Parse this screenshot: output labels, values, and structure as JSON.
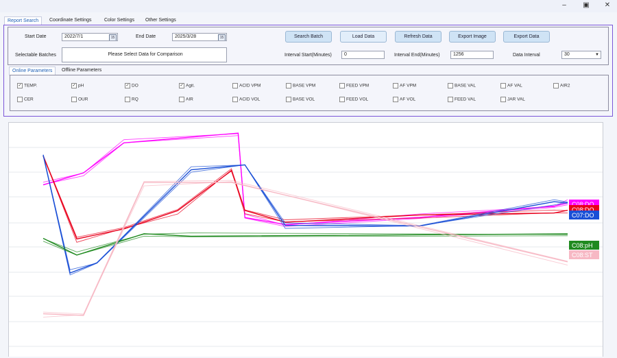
{
  "window": {
    "minimize_icon": "minimize-icon",
    "restore_icon": "restore-icon",
    "close_icon": "close-icon"
  },
  "top_tabs": [
    {
      "label": "Report Search",
      "active": true
    },
    {
      "label": "Coordinate Settings",
      "active": false
    },
    {
      "label": "Color Settings",
      "active": false
    },
    {
      "label": "Other Settings",
      "active": false
    }
  ],
  "search": {
    "start_date_label": "Start Date",
    "start_date_value": "2022/7/1",
    "end_date_label": "End Date",
    "end_date_value": "2025/3/28",
    "calendar_icon": "calendar-icon",
    "selectable_batches_label": "Selectable Batches",
    "selectable_batches_value": "Please Select Data for Comparison",
    "interval_start_label": "Interval Start(Minutes)",
    "interval_start_value": "0",
    "interval_end_label": "Interval End(Minutes)",
    "interval_end_value": "1256",
    "data_interval_label": "Data Interval",
    "data_interval_value": "30"
  },
  "buttons": {
    "search_batch": "Search Batch",
    "load_data": "Load Data",
    "refresh_data": "Refresh Data",
    "export_image": "Export Image",
    "export_data": "Export Data"
  },
  "param_tabs": [
    {
      "label": "Online Parameters",
      "active": true
    },
    {
      "label": "Offline Parameters",
      "active": false
    }
  ],
  "parameters": [
    {
      "label": "TEMP.",
      "checked": true
    },
    {
      "label": "pH",
      "checked": true
    },
    {
      "label": "DO",
      "checked": true
    },
    {
      "label": "Agit.",
      "checked": true
    },
    {
      "label": "ACID VPM",
      "checked": false
    },
    {
      "label": "BASE VPM",
      "checked": false
    },
    {
      "label": "FEED VPM",
      "checked": false
    },
    {
      "label": "AF VPM",
      "checked": false
    },
    {
      "label": "BASE VAL",
      "checked": false
    },
    {
      "label": "AF VAL",
      "checked": false
    },
    {
      "label": "AIR2",
      "checked": false
    },
    {
      "label": "CER",
      "checked": false
    },
    {
      "label": "OUR",
      "checked": false
    },
    {
      "label": "RQ",
      "checked": false
    },
    {
      "label": "AIR",
      "checked": false
    },
    {
      "label": "ACID VOL",
      "checked": false
    },
    {
      "label": "BASE VOL",
      "checked": false
    },
    {
      "label": "FEED VOL",
      "checked": false
    },
    {
      "label": "AF VOL",
      "checked": false
    },
    {
      "label": "FEED VAL",
      "checked": false
    },
    {
      "label": "JAR VAL",
      "checked": false
    }
  ],
  "chart_labels": [
    {
      "text": "C08:DO",
      "color": "#ff00ff",
      "text_color": "#ffffff"
    },
    {
      "text": "C08:DO",
      "color": "#e8001c",
      "text_color": "#ffffff"
    },
    {
      "text": "C07:DO",
      "color": "#1a4fd6",
      "text_color": "#ffffff"
    },
    {
      "text": "C08:pH",
      "color": "#1f8a1f",
      "text_color": "#ffffff"
    },
    {
      "text": "C08:ST",
      "color": "#f7b8c4",
      "text_color": "#ffffff"
    }
  ],
  "chart_data": {
    "type": "line",
    "grid": true,
    "series": [
      {
        "name": "C08:DO",
        "color": "#ff00ff",
        "points": [
          [
            0,
            0.74
          ],
          [
            60,
            0.78
          ],
          [
            120,
            0.92
          ],
          [
            290,
            0.95
          ],
          [
            300,
            0.6
          ],
          [
            360,
            0.56
          ],
          [
            560,
            0.6
          ],
          [
            760,
            0.64
          ],
          [
            780,
            0.66
          ]
        ]
      },
      {
        "name": "C08:DO",
        "color": "#e8001c",
        "points": [
          [
            0,
            0.86
          ],
          [
            50,
            0.5
          ],
          [
            120,
            0.55
          ],
          [
            200,
            0.62
          ],
          [
            280,
            0.8
          ],
          [
            300,
            0.62
          ],
          [
            360,
            0.58
          ],
          [
            560,
            0.6
          ],
          [
            760,
            0.62
          ],
          [
            780,
            0.62
          ]
        ]
      },
      {
        "name": "C07:DO",
        "color": "#1a4fd6",
        "points": [
          [
            0,
            0.86
          ],
          [
            40,
            0.36
          ],
          [
            80,
            0.4
          ],
          [
            220,
            0.8
          ],
          [
            300,
            0.82
          ],
          [
            360,
            0.56
          ],
          [
            560,
            0.56
          ],
          [
            760,
            0.66
          ],
          [
            780,
            0.66
          ]
        ]
      },
      {
        "name": "C08:pH",
        "color": "#1f8a1f",
        "points": [
          [
            0,
            0.5
          ],
          [
            50,
            0.44
          ],
          [
            150,
            0.52
          ],
          [
            220,
            0.52
          ],
          [
            780,
            0.52
          ]
        ]
      },
      {
        "name": "C08:ST",
        "color": "#f7b8c4",
        "points": [
          [
            0,
            0.18
          ],
          [
            60,
            0.18
          ],
          [
            150,
            0.74
          ],
          [
            280,
            0.75
          ],
          [
            780,
            0.4
          ]
        ]
      }
    ]
  }
}
